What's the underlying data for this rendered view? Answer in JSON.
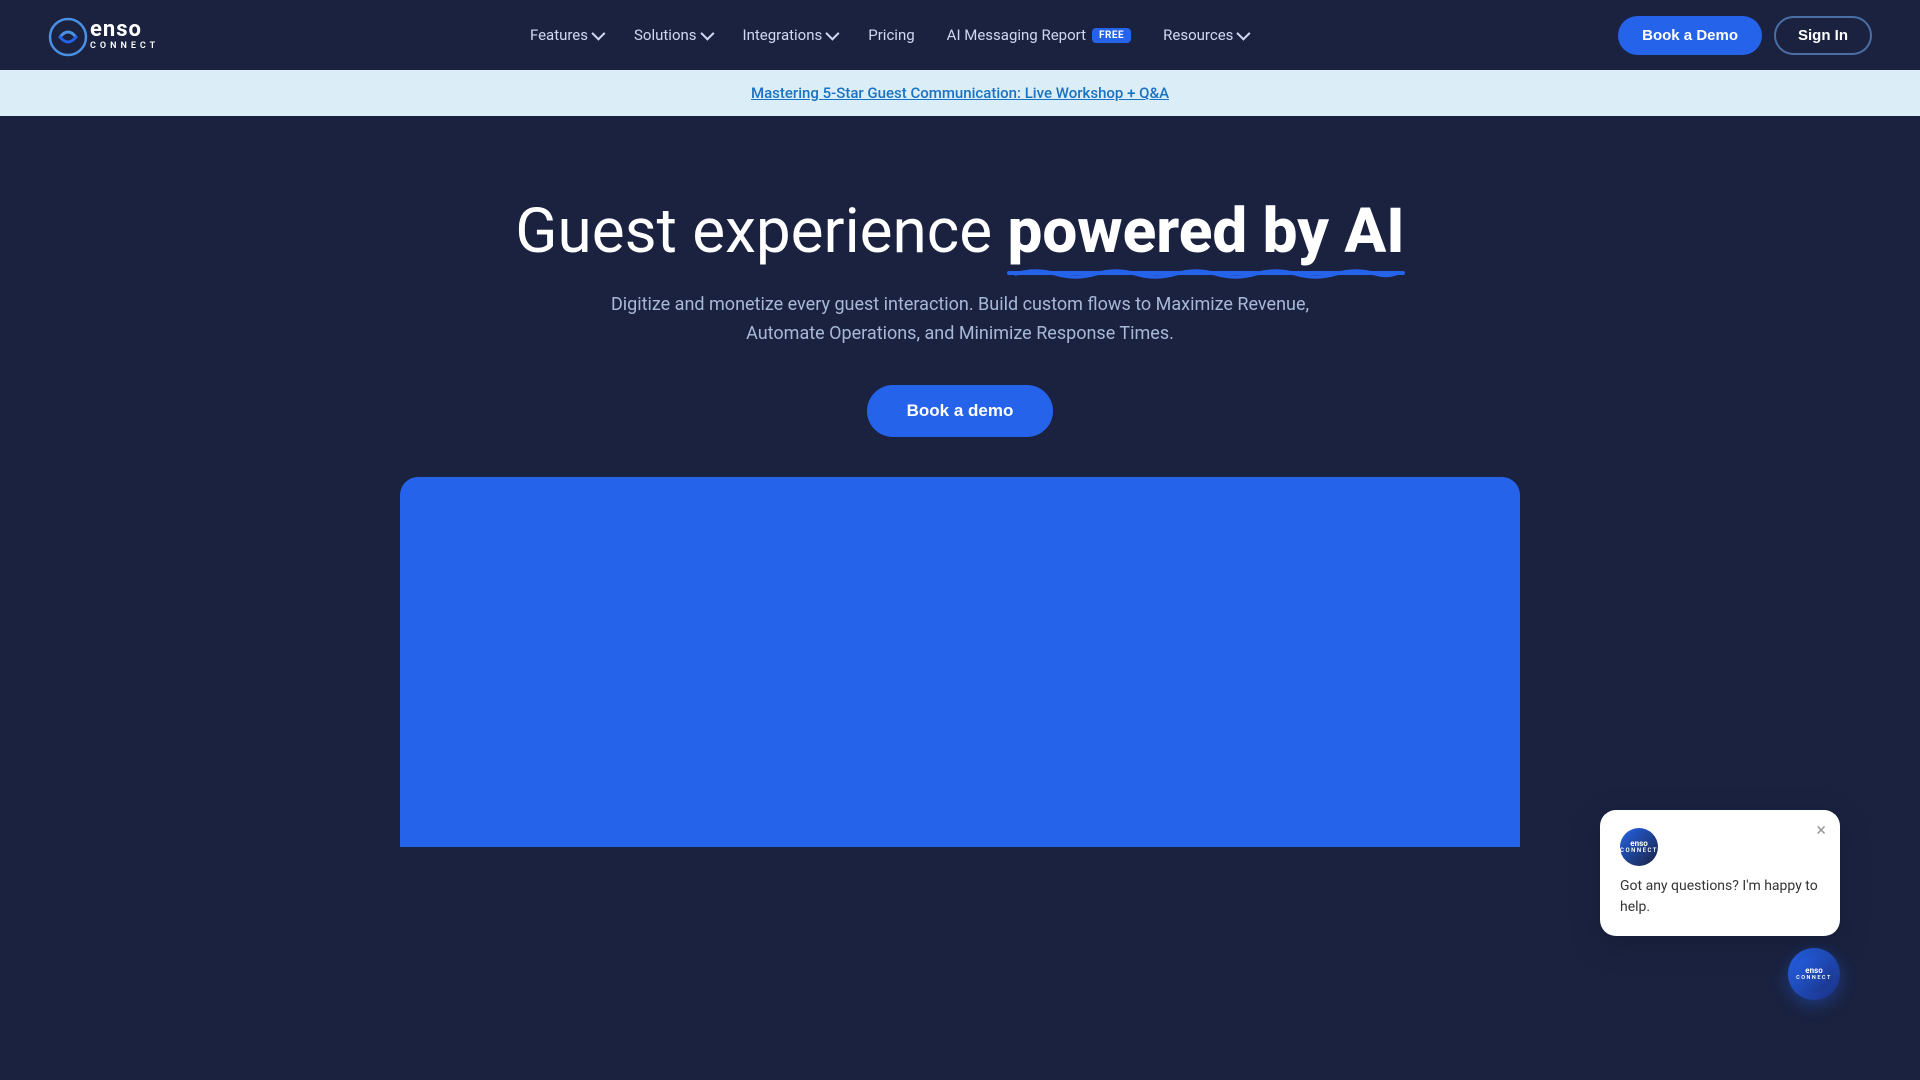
{
  "logo": {
    "top": "enso",
    "bottom": "CONNECT"
  },
  "nav": {
    "links": [
      {
        "id": "features",
        "label": "Features",
        "hasDropdown": true
      },
      {
        "id": "solutions",
        "label": "Solutions",
        "hasDropdown": true
      },
      {
        "id": "integrations",
        "label": "Integrations",
        "hasDropdown": true
      },
      {
        "id": "pricing",
        "label": "Pricing",
        "hasDropdown": false
      },
      {
        "id": "ai-report",
        "label": "AI Messaging Report",
        "badge": "FREE"
      },
      {
        "id": "resources",
        "label": "Resources",
        "hasDropdown": true
      }
    ],
    "book_demo_label": "Book a Demo",
    "sign_in_label": "Sign In"
  },
  "announcement": {
    "text": "Mastering 5-Star Guest Communication: Live Workshop + Q&A",
    "link": "Mastering 5-Star Guest Communication: Live Workshop + Q&A"
  },
  "hero": {
    "title_start": "Guest experience ",
    "title_bold": "powered by AI",
    "subtitle": "Digitize and monetize every guest interaction. Build custom flows to Maximize Revenue, Automate Operations, and Minimize Response Times.",
    "cta_label": "Book a demo"
  },
  "chat": {
    "avatar_line1": "enso",
    "avatar_line2": "connect",
    "message": "Got any questions? I'm happy to help.",
    "close_label": "×"
  },
  "colors": {
    "bg_dark": "#1a2240",
    "accent_blue": "#2563eb",
    "announcement_bg": "#dbeef8",
    "announcement_link": "#1a72c2"
  }
}
